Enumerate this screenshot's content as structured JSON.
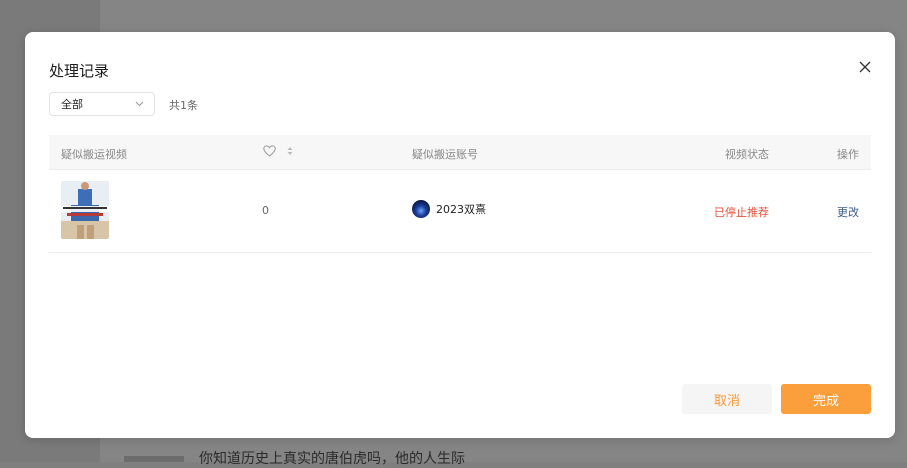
{
  "background": {
    "bottom_text": "你知道历史上真实的唐伯虎吗，他的人生际"
  },
  "modal": {
    "title": "处理记录",
    "close_icon": "close-icon",
    "filter": {
      "selected": "全部",
      "icon": "chevron-down-icon"
    },
    "total": "共1条",
    "columns": {
      "video": "疑似搬运视频",
      "likes_icon": "heart-icon",
      "sort_icon": "sort-icon",
      "account": "疑似搬运账号",
      "status": "视频状态",
      "action": "操作"
    },
    "rows": [
      {
        "likes": "0",
        "account_name": "2023双熹",
        "status": "已停止推荐",
        "action": "更改"
      }
    ],
    "buttons": {
      "cancel": "取消",
      "confirm": "完成"
    }
  },
  "colors": {
    "accent": "#fa9f3c",
    "status_red": "#e5533f",
    "link": "#3c5b8a"
  }
}
